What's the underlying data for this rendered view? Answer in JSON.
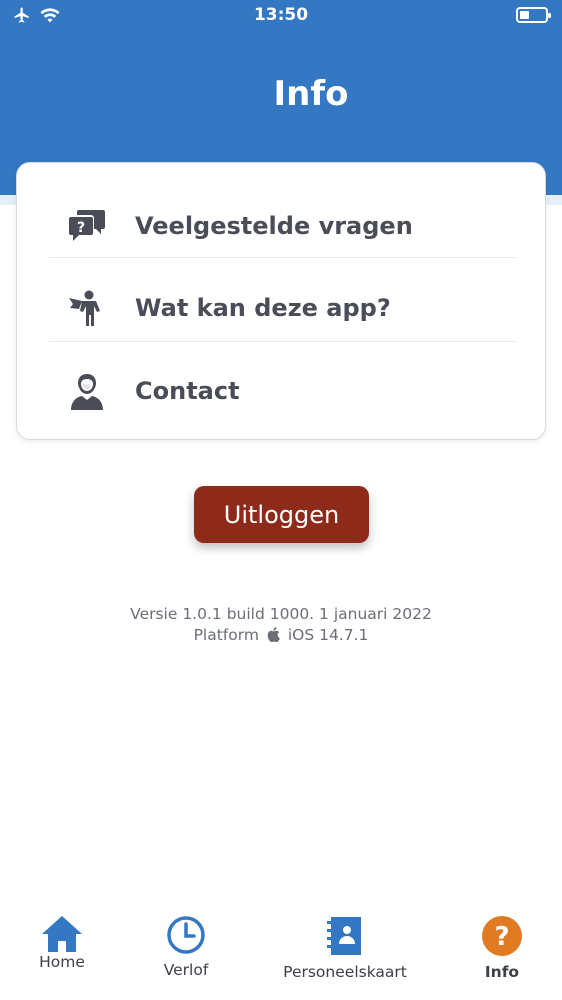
{
  "status_bar": {
    "time": "13:50"
  },
  "header": {
    "title": "Info"
  },
  "menu": {
    "items": [
      {
        "label": "Veelgestelde vragen",
        "icon": "faq-chat-icon"
      },
      {
        "label": "Wat kan deze app?",
        "icon": "superhero-icon"
      },
      {
        "label": "Contact",
        "icon": "support-agent-icon"
      }
    ]
  },
  "logout": {
    "label": "Uitloggen"
  },
  "version": {
    "line1": "Versie 1.0.1 build 1000. 1 januari 2022",
    "platform_prefix": "Platform",
    "platform_value": "iOS 14.7.1"
  },
  "tabbar": {
    "tabs": [
      {
        "label": "Home",
        "icon": "home-icon"
      },
      {
        "label": "Verlof",
        "icon": "clock-icon"
      },
      {
        "label": "Personeelskaart",
        "icon": "contact-book-icon"
      },
      {
        "label": "Info",
        "icon": "question-icon",
        "active": true
      }
    ]
  },
  "colors": {
    "header": "#3477c2",
    "logout": "#8e2a1a",
    "tab_icon": "#3477c2",
    "info_active": "#e07b24",
    "text": "#4a4d57"
  }
}
